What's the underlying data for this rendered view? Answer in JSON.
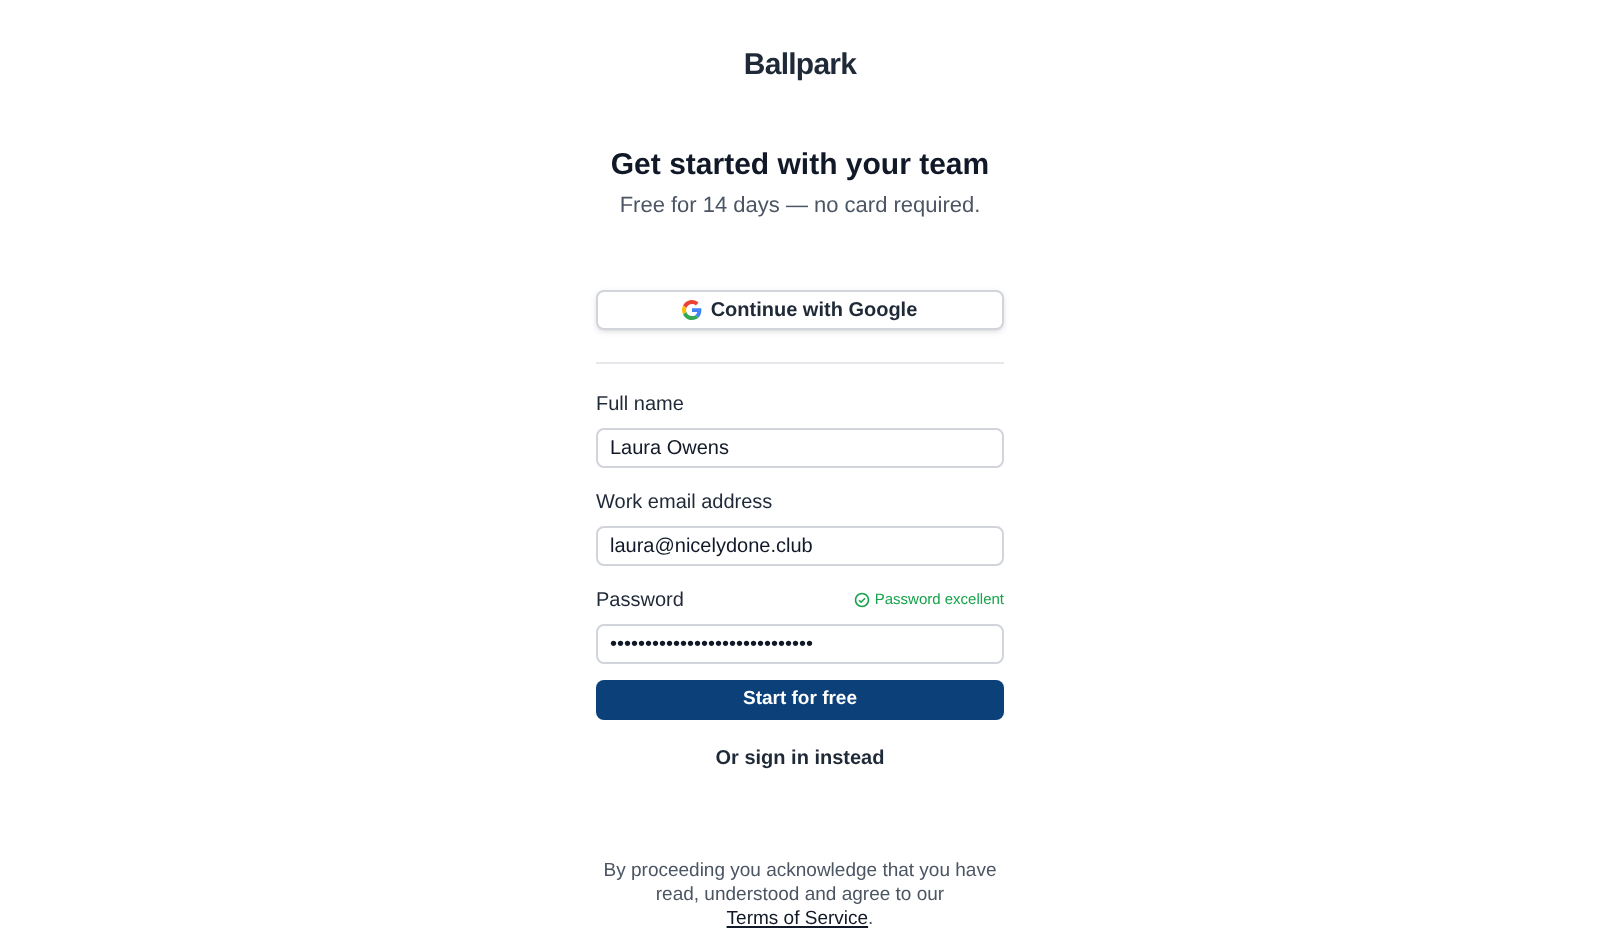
{
  "logo": "Ballpark",
  "heading": "Get started with your team",
  "subtitle": "Free for 14 days — no card required.",
  "google_button": "Continue with Google",
  "fields": [
    {
      "label": "Full name",
      "value": "Laura Owens"
    },
    {
      "label": "Work email address",
      "value": "laura@nicelydone.club"
    },
    {
      "label": "Password",
      "value": "•••••••••••••••••••••••••••••",
      "strength": "Password excellent"
    }
  ],
  "submit_button": "Start for free",
  "signin_link": "Or sign in instead",
  "footer": {
    "text": "By proceeding you acknowledge that you have read, understood and agree to our ",
    "link": "Terms of Service",
    "end": "."
  }
}
